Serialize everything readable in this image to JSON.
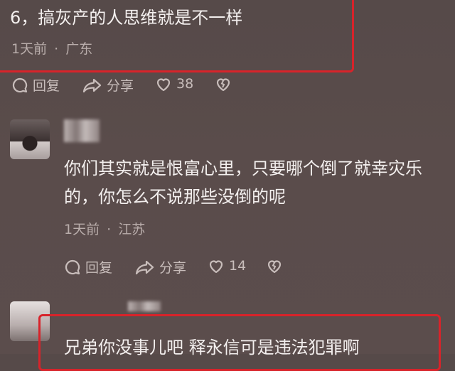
{
  "comments": [
    {
      "text": "6，搞灰产的人思维就是不一样",
      "time": "1天前",
      "separator": "·",
      "location": "广东",
      "actions": {
        "reply": "回复",
        "share": "分享",
        "likes": "38"
      }
    },
    {
      "text_line1": "你们其实就是恨富心里，只要哪个倒了就幸灾乐",
      "text_line2": "的，你怎么不说那些没倒的呢",
      "time": "1天前",
      "separator": "·",
      "location": "江苏",
      "actions": {
        "reply": "回复",
        "share": "分享",
        "likes": "14"
      }
    },
    {
      "text": "兄弟你没事儿吧 释永信可是违法犯罪啊"
    }
  ],
  "icons": {
    "reply": "reply-bubble-icon",
    "share": "share-arrow-icon",
    "like": "heart-icon",
    "dislike": "broken-heart-icon"
  },
  "colors": {
    "background": "#584b4a",
    "highlight": "#d8232a",
    "text": "#f3efee",
    "meta": "#b9adab"
  }
}
